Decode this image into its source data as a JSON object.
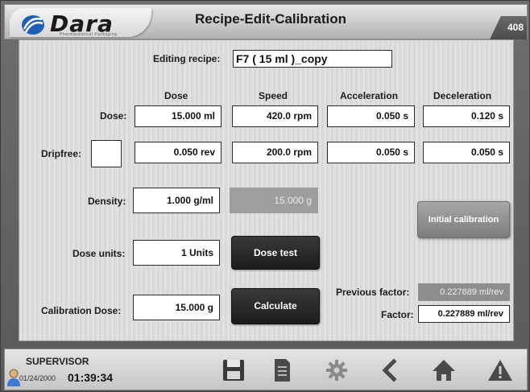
{
  "header": {
    "logo_text": "Dara",
    "logo_sub": "Pharmaceutical Packaging",
    "title": "Recipe-Edit-Calibration",
    "screen_number": "408"
  },
  "recipe": {
    "label": "Editing recipe:",
    "value": "F7 ( 15 ml )_copy"
  },
  "columns": {
    "dose": "Dose",
    "speed": "Speed",
    "acceleration": "Acceleration",
    "deceleration": "Deceleration"
  },
  "dose_row": {
    "label": "Dose:",
    "dose": "15.000  ml",
    "speed": "420.0 rpm",
    "acceleration": "0.050 s",
    "deceleration": "0.120 s"
  },
  "dripfree_row": {
    "label": "Dripfree:",
    "dose": "0.050 rev",
    "speed": "200.0 rpm",
    "acceleration": "0.050 s",
    "deceleration": "0.050 s"
  },
  "density": {
    "label": "Density:",
    "value": "1.000 g/ml",
    "computed": "15.000 g"
  },
  "dose_units": {
    "label": "Dose units:",
    "value": "1 Units"
  },
  "calibration_dose": {
    "label": "Calibration Dose:",
    "value": "15.000 g"
  },
  "factors": {
    "previous_label": "Previous factor:",
    "previous_value": "0.227889 ml/rev",
    "factor_label": "Factor:",
    "factor_value": "0.227889 ml/rev"
  },
  "buttons": {
    "dose_test": "Dose test",
    "calculate": "Calculate",
    "initial_calibration": "Initial calibration"
  },
  "footer": {
    "user": "SUPERVISOR",
    "date": "01/24/2000",
    "time": "01:39:34",
    "icons": [
      "save-icon",
      "document-icon",
      "gear-icon",
      "back-icon",
      "home-icon",
      "warning-icon"
    ]
  }
}
